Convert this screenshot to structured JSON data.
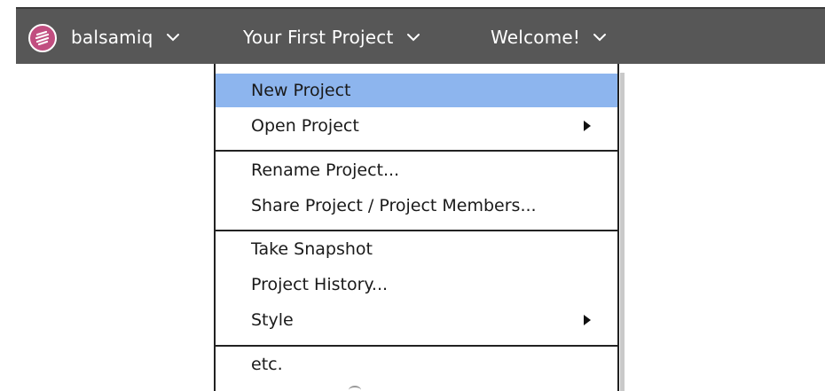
{
  "menubar": {
    "color": "#575757",
    "logo_color": "#c14e80",
    "items": [
      {
        "label": "balsamiq"
      },
      {
        "label": "Your First Project"
      },
      {
        "label": "Welcome!"
      }
    ]
  },
  "dropdown": {
    "selected_color": "#8db5ee",
    "items": [
      {
        "label": "New Project",
        "selected": true
      },
      {
        "label": "Open Project",
        "has_submenu": true
      },
      {
        "label": "Rename Project..."
      },
      {
        "label": "Share Project / Project Members..."
      },
      {
        "label": "Take Snapshot"
      },
      {
        "label": "Project History..."
      },
      {
        "label": "Style",
        "has_submenu": true
      },
      {
        "label": "etc."
      }
    ]
  }
}
